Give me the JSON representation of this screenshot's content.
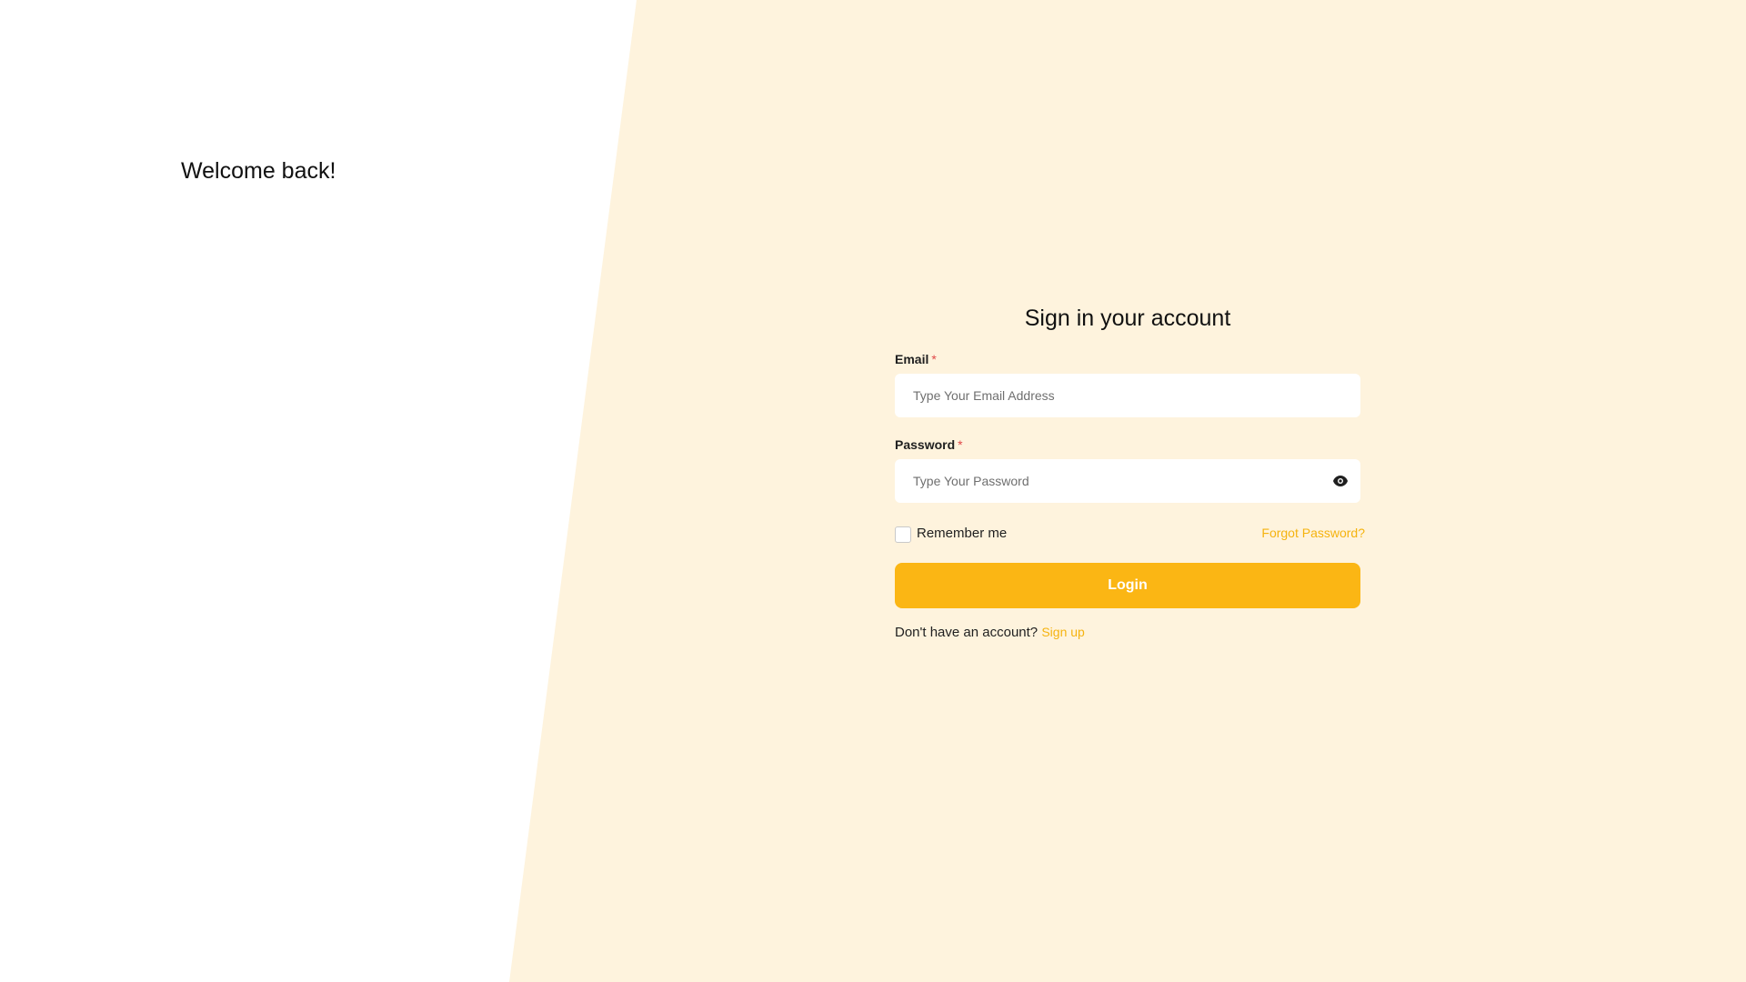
{
  "left_panel": {
    "welcome_text": "Welcome back!"
  },
  "form": {
    "title": "Sign in your account",
    "email": {
      "label": "Email",
      "required_mark": "*",
      "placeholder": "Type Your Email Address",
      "value": ""
    },
    "password": {
      "label": "Password",
      "required_mark": "*",
      "placeholder": "Type Your Password",
      "value": "",
      "toggle_icon": "eye-icon"
    },
    "remember_me": {
      "label": "Remember me",
      "checked": false
    },
    "forgot_password_label": "Forgot Password?",
    "login_button_label": "Login",
    "signup_prompt": "Don't have an account?",
    "signup_link_label": "Sign up"
  },
  "colors": {
    "accent": "#fbb614",
    "link": "#f5b30f",
    "panel_background": "#fef3dd",
    "required": "#e04848"
  }
}
